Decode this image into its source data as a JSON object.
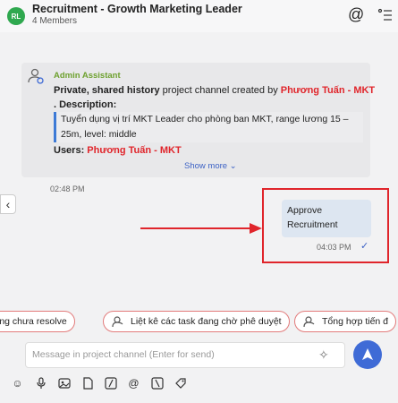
{
  "header": {
    "avatar_initials": "RL",
    "title": "Recruitment - Growth Marketing Leader",
    "subtitle": "4 Members"
  },
  "message": {
    "sender": "Admin Assistant",
    "line1_bold": "Private, shared history",
    "line1_text": " project channel created by ",
    "creator": "Phương Tuấn - MKT",
    "description_label": ". Description:",
    "description": "Tuyển dụng vị trí MKT Leader cho phòng ban MKT, range lương 15 – 25m, level: middle",
    "users_label": "Users: ",
    "users_value": "Phương Tuấn - MKT",
    "show_more": "Show more ⌄",
    "timestamp": "02:48 PM"
  },
  "reply": {
    "text": "Approve Recruitment",
    "timestamp": "04:03 PM",
    "status": "✓"
  },
  "chips": [
    "ing chưa resolve",
    "Liệt kê các task đang chờ phê duyệt",
    "Tổng hợp tiến đ"
  ],
  "composer": {
    "placeholder": "Message in project channel (Enter for send)"
  },
  "colors": {
    "accent": "#3f6bd6",
    "sender_green": "#6ea12f",
    "highlight_red": "#e0252b"
  }
}
